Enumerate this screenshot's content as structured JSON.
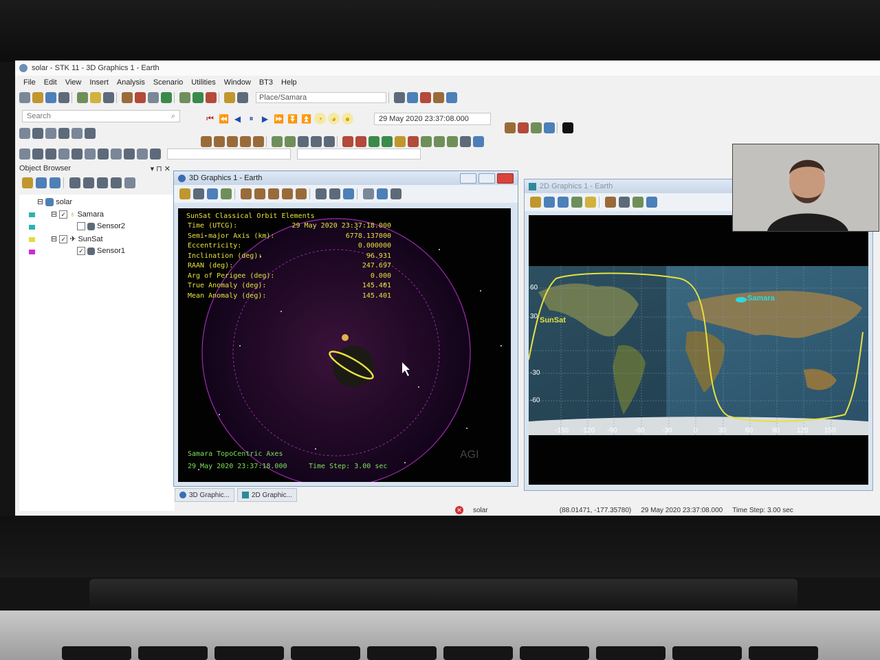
{
  "window": {
    "title": "solar - STK 11 - 3D Graphics 1 - Earth"
  },
  "menu": [
    "File",
    "Edit",
    "View",
    "Insert",
    "Analysis",
    "Scenario",
    "Utilities",
    "Window",
    "BT3",
    "Help"
  ],
  "toolbar": {
    "place_combo": "Place/Samara",
    "search_placeholder": "Search",
    "animation_time": "29 May 2020 23:37:08.000"
  },
  "object_browser": {
    "title": "Object Browser",
    "items": [
      {
        "label": "solar",
        "checked": null,
        "swatch": ""
      },
      {
        "label": "Samara",
        "checked": true,
        "swatch": "#2bb3b3"
      },
      {
        "label": "Sensor2",
        "checked": false,
        "swatch": "#2bb3b3"
      },
      {
        "label": "SunSat",
        "checked": true,
        "swatch": "#e6d84a"
      },
      {
        "label": "Sensor1",
        "checked": true,
        "swatch": "#d02bd0"
      }
    ]
  },
  "graphics3d": {
    "title": "3D Graphics 1 - Earth",
    "report_title": "SunSat Classical Orbit Elements",
    "rows": [
      {
        "label": "Time (UTCG):",
        "value": "29 May 2020 23:37:18.000"
      },
      {
        "label": "Semi-major Axis (km):",
        "value": "6778.137000"
      },
      {
        "label": "Eccentricity:",
        "value": "0.000000"
      },
      {
        "label": "Inclination (deg):",
        "value": "96.931"
      },
      {
        "label": "RAAN (deg):",
        "value": "247.697"
      },
      {
        "label": "Arg of Perigee (deg):",
        "value": "0.000"
      },
      {
        "label": "True Anomaly (deg):",
        "value": "145.401"
      },
      {
        "label": "Mean Anomaly (deg):",
        "value": "145.401"
      }
    ],
    "axes_label": "Samara TopoCentric Axes",
    "scene_time": "29 May 2020 23:37:18.000",
    "time_step": "Time Step: 3.00 sec",
    "watermark": "AGI"
  },
  "graphics2d": {
    "title": "2D Graphics 1 - Earth",
    "lat_labels": [
      "60",
      "30",
      "-30",
      "-60"
    ],
    "lon_labels": [
      "-150",
      "-120",
      "-90",
      "-60",
      "-30",
      "0",
      "30",
      "60",
      "90",
      "120",
      "150"
    ],
    "satellite_label": "SunSat",
    "facility_label": "Samara"
  },
  "tabs": [
    {
      "label": "3D Graphic..."
    },
    {
      "label": "2D Graphic..."
    }
  ],
  "statusbar": {
    "scenario": "solar",
    "coords": "(88.01471, -177.35780)",
    "time": "29 May 2020 23:37:08.000",
    "time_step": "Time Step: 3.00 sec"
  },
  "colors": {
    "orbit_yellow": "#e6e040",
    "sensor_magenta": "#c02ec0",
    "report_green": "#7fe05a",
    "facility_cyan": "#2fd6e0",
    "close_red": "#d9443a"
  }
}
